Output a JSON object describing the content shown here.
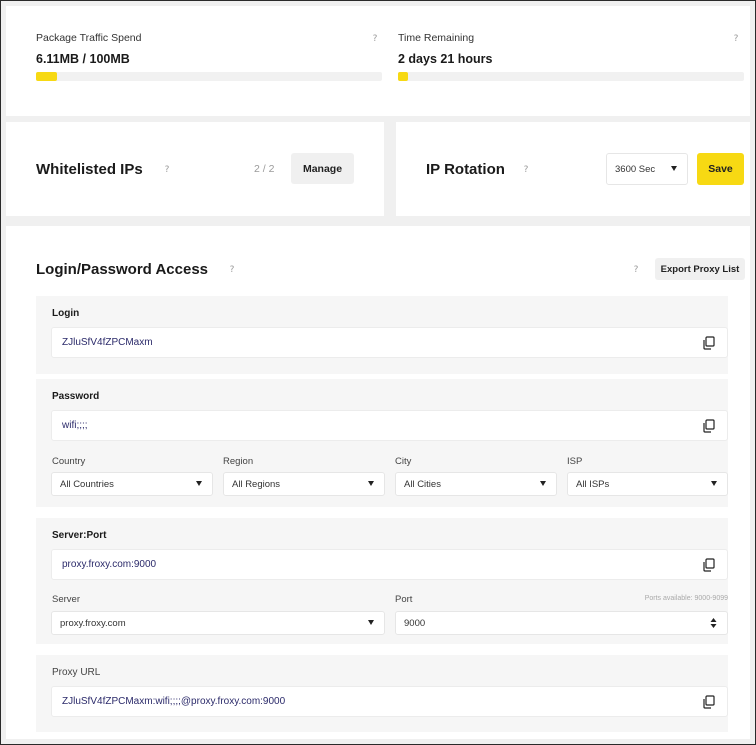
{
  "traffic": {
    "label": "Package Traffic Spend",
    "value": "6.11MB / 100MB",
    "progress": 0.061
  },
  "time": {
    "label": "Time Remaining",
    "value": "2 days 21 hours",
    "progress": 0.02
  },
  "help_glyph": "?",
  "whitelist": {
    "title": "Whitelisted IPs",
    "count": "2 / 2",
    "manage_label": "Manage"
  },
  "rotation": {
    "title": "IP Rotation",
    "interval": "3600 Sec",
    "save_label": "Save"
  },
  "access": {
    "title": "Login/Password Access",
    "export_label": "Export Proxy List",
    "login": {
      "label": "Login",
      "value": "ZJluSfV4fZPCMaxm"
    },
    "password": {
      "label": "Password",
      "value": "wifi;;;;"
    },
    "filters": {
      "country": {
        "label": "Country",
        "value": "All Countries"
      },
      "region": {
        "label": "Region",
        "value": "All Regions"
      },
      "city": {
        "label": "City",
        "value": "All Cities"
      },
      "isp": {
        "label": "ISP",
        "value": "All ISPs"
      }
    },
    "server_port": {
      "label": "Server:Port",
      "value": "proxy.froxy.com:9000"
    },
    "server": {
      "label": "Server",
      "value": "proxy.froxy.com"
    },
    "port": {
      "label": "Port",
      "value": "9000",
      "hint": "Ports available: 9000-9099"
    },
    "proxy_url": {
      "label": "Proxy URL",
      "value": "ZJluSfV4fZPCMaxm:wifi;;;;@proxy.froxy.com:9000"
    }
  },
  "colors": {
    "accent": "#f7d913",
    "value_text": "#2b2a6a",
    "panel": "#f6f6f6"
  }
}
